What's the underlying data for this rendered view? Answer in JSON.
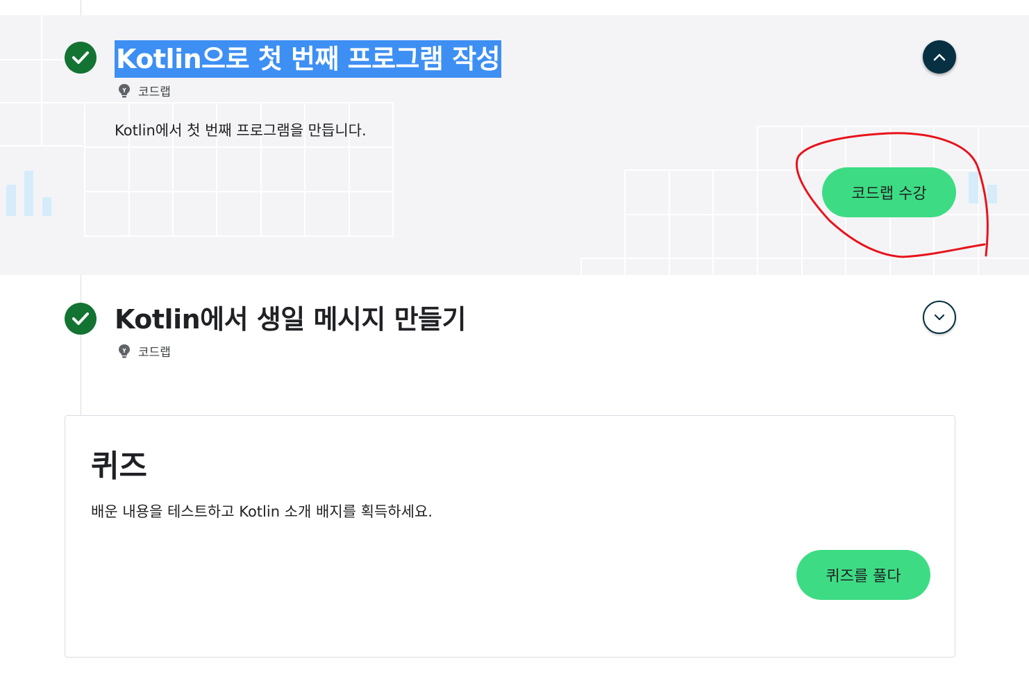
{
  "steps": [
    {
      "title": "Kotlin으로 첫 번째 프로그램 작성",
      "type_label": "코드랩",
      "description": "Kotlin에서 첫 번째 프로그램을 만듭니다.",
      "cta_label": "코드랩 수강",
      "expanded": true,
      "completed": true
    },
    {
      "title": "Kotlin에서 생일 메시지 만들기",
      "type_label": "코드랩",
      "expanded": false,
      "completed": true
    }
  ],
  "quiz": {
    "title": "퀴즈",
    "description": "배운 내용을 테스트하고 Kotlin 소개 배지를 획득하세요.",
    "cta_label": "퀴즈를 풀다"
  },
  "colors": {
    "check_green": "#137333",
    "cta_green": "#3ddc84",
    "toggle_dark": "#073042",
    "selection_blue": "#3d8ff3",
    "annotation_red": "#e8121b",
    "panel_bg": "#f4f4f6"
  },
  "icons": {
    "completed": "check-circle-icon",
    "codelab": "lightbulb-icon",
    "collapse": "chevron-up-icon",
    "expand": "chevron-down-icon"
  }
}
